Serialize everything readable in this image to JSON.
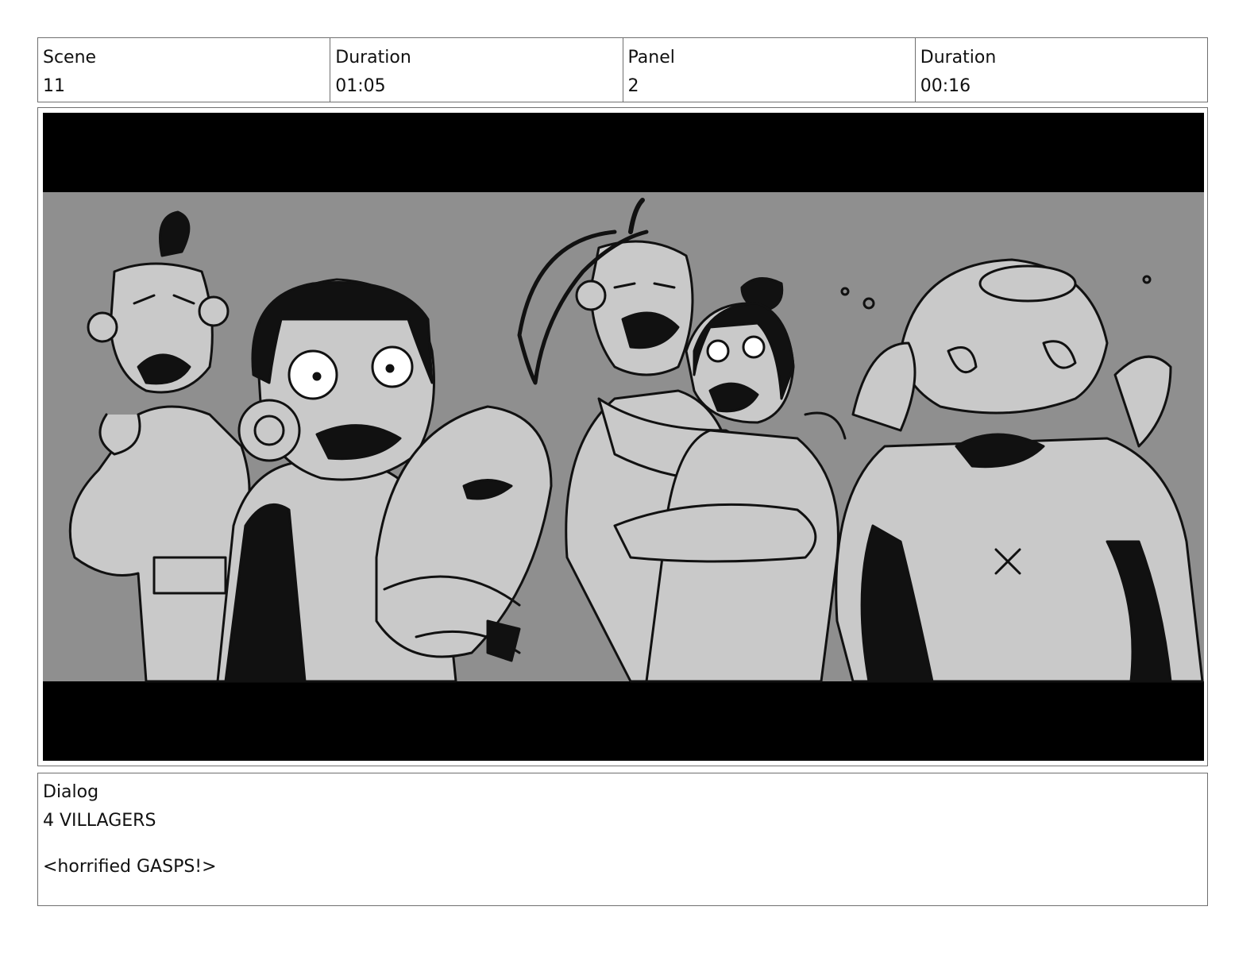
{
  "header": {
    "scene_label": "Scene",
    "scene_value": "11",
    "duration_label": "Duration",
    "duration_value": "01:05",
    "panel_label": "Panel",
    "panel_value": "2",
    "panel_duration_label": "Duration",
    "panel_duration_value": "00:16"
  },
  "dialog": {
    "label": "Dialog",
    "character": "4 VILLAGERS",
    "line": "<horrified GASPS!>"
  },
  "colors": {
    "letterbox": "#000000",
    "background": "#8f8f8f",
    "figure_fill": "#c9c9c9",
    "ink": "#111111",
    "border": "#6f6f6f"
  }
}
